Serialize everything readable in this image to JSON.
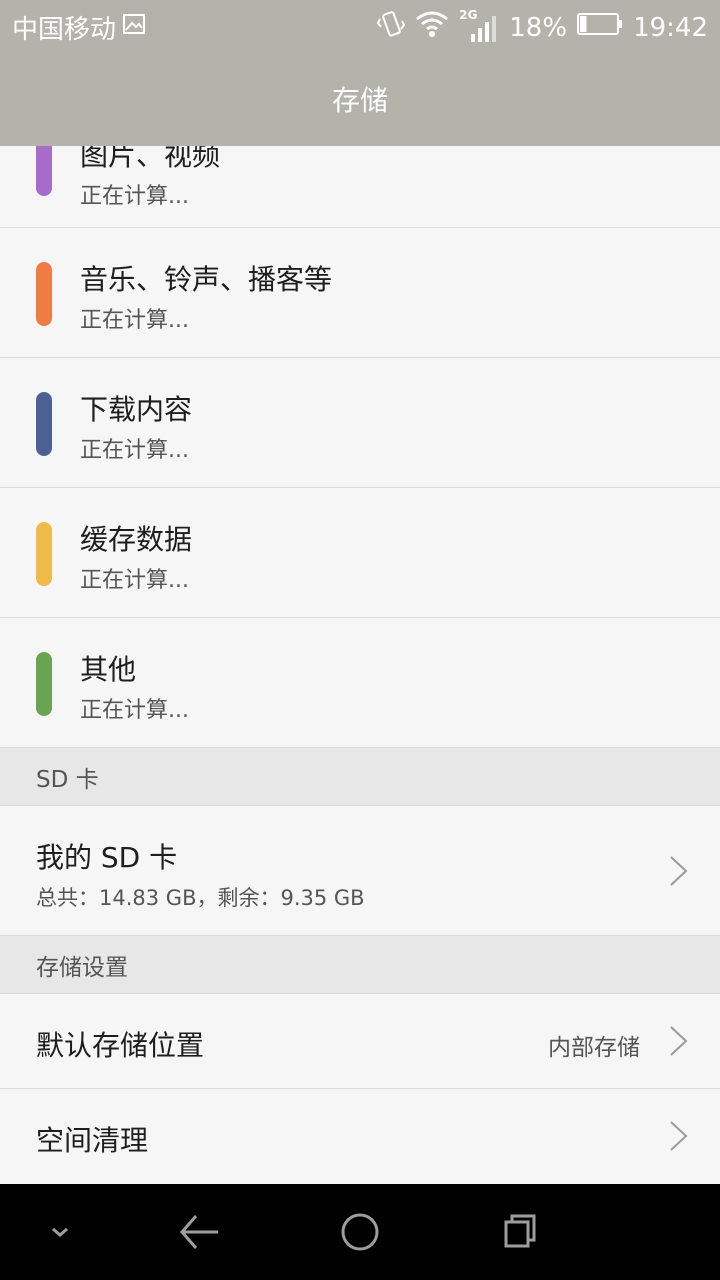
{
  "status_bar": {
    "carrier": "中国移动",
    "network_label": "2G",
    "battery": "18%",
    "battery_level": 0.18,
    "time": "19:42"
  },
  "action_bar": {
    "title": "存储"
  },
  "categories": [
    {
      "title": "图片、视频",
      "status": "正在计算...",
      "color": "#a56cc9"
    },
    {
      "title": "音乐、铃声、播客等",
      "status": "正在计算...",
      "color": "#ee7c43"
    },
    {
      "title": "下载内容",
      "status": "正在计算...",
      "color": "#4c6093"
    },
    {
      "title": "缓存数据",
      "status": "正在计算...",
      "color": "#f0bb48"
    },
    {
      "title": "其他",
      "status": "正在计算...",
      "color": "#6aa352"
    }
  ],
  "sd_section": {
    "header": "SD 卡",
    "card_title": "我的 SD 卡",
    "card_summary": "总共：14.83 GB，剩余：9.35 GB"
  },
  "settings_section": {
    "header": "存储设置",
    "default_location_label": "默认存储位置",
    "default_location_value": "内部存储",
    "cleanup_label": "空间清理"
  },
  "icons": {
    "gallery": "image-icon",
    "vibrate": "vibrate-icon",
    "wifi": "wifi-icon",
    "signal": "signal-icon",
    "battery": "battery-icon",
    "nav_hide": "chevron-down-icon",
    "nav_back": "back-arrow-icon",
    "nav_home": "home-circle-icon",
    "nav_recents": "recents-icon"
  }
}
